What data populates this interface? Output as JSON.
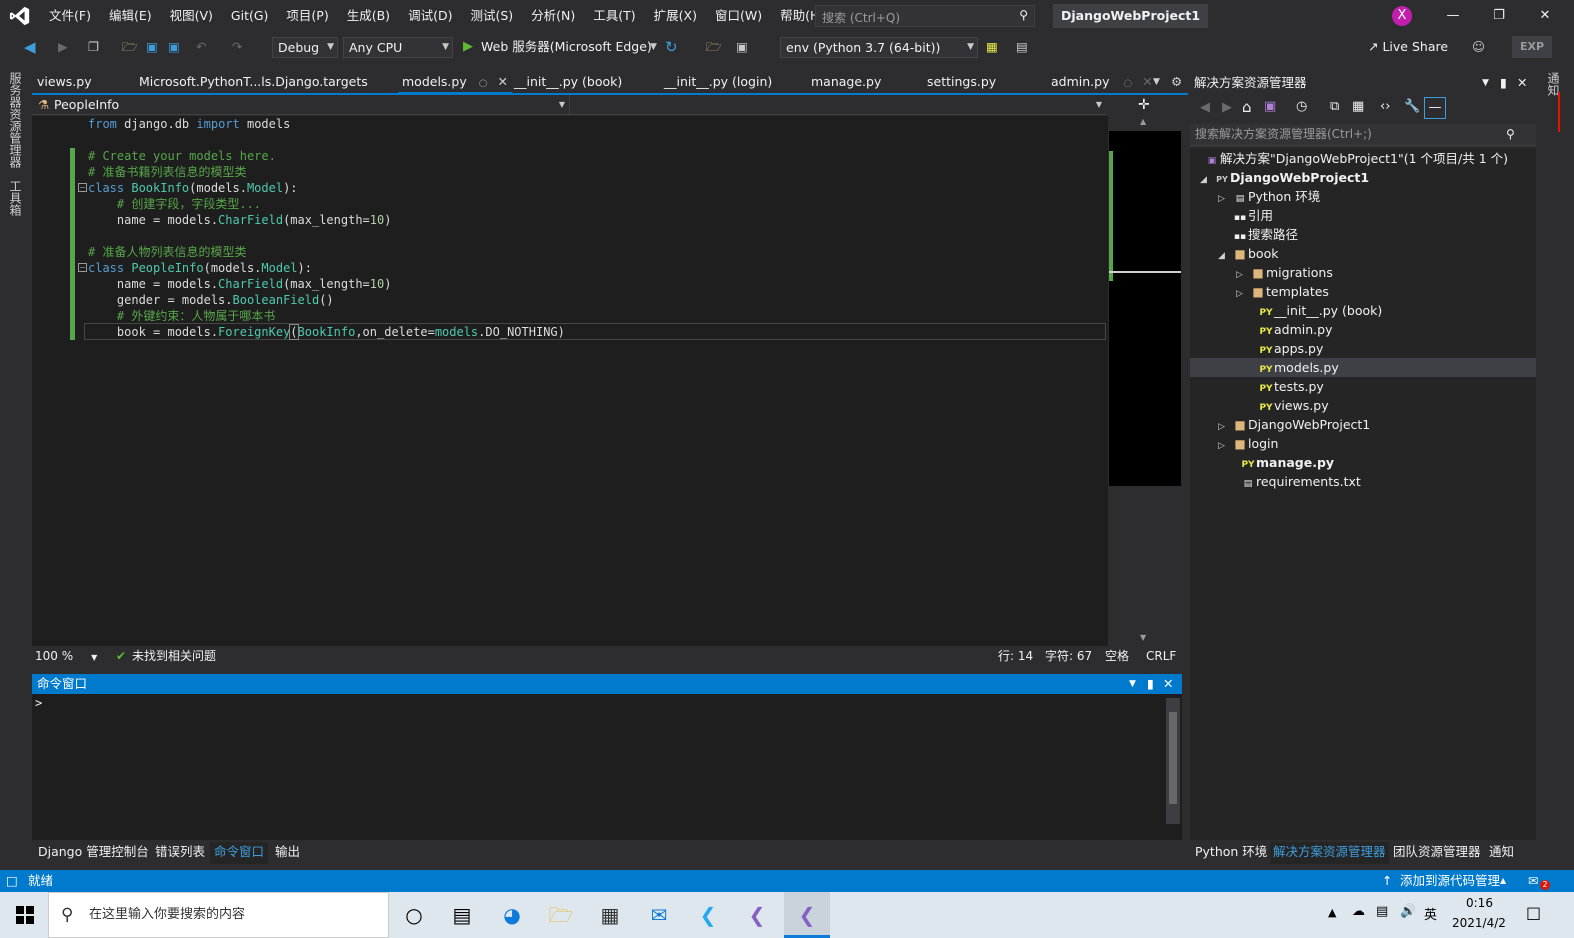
{
  "menu": {
    "items": [
      "文件(F)",
      "编辑(E)",
      "视图(V)",
      "Git(G)",
      "项目(P)",
      "生成(B)",
      "调试(D)",
      "测试(S)",
      "分析(N)",
      "工具(T)",
      "扩展(X)",
      "窗口(W)",
      "帮助(H)"
    ],
    "search_placeholder": "搜索 (Ctrl+Q)",
    "project_title": "DjangoWebProject1",
    "avatar_letter": "X"
  },
  "toolbar": {
    "config": "Debug",
    "platform": "Any CPU",
    "run_label": "Web 服务器(Microsoft Edge)",
    "env": "env (Python 3.7 (64-bit))",
    "live_share": "Live Share",
    "exp": "EXP"
  },
  "left_strip": {
    "server_explorer": "服务器资源管理器",
    "toolbox": "工具箱"
  },
  "doc_tabs": [
    {
      "label": "views.py"
    },
    {
      "label": "Microsoft.PythonT...ls.Django.targets"
    },
    {
      "label": "models.py"
    },
    {
      "label": "__init__.py (book)"
    },
    {
      "label": "__init__.py (login)"
    },
    {
      "label": "manage.py"
    },
    {
      "label": "settings.py"
    },
    {
      "label": "admin.py"
    }
  ],
  "navbar": {
    "class_selector": "PeopleInfo"
  },
  "code": {
    "l1_a": "from",
    "l1_b": " django.db ",
    "l1_c": "import",
    "l1_d": " models",
    "l3": "# Create your models here.",
    "l4": "# 准备书籍列表信息的模型类",
    "l5_a": "class",
    "l5_b": " ",
    "l5_c": "BookInfo",
    "l5_d": "(models.",
    "l5_e": "Model",
    "l5_f": "):",
    "l6": "    # 创建字段，字段类型...",
    "l7_a": "    name = models.",
    "l7_b": "CharField",
    "l7_c": "(max_length=",
    "l7_d": "10",
    "l7_e": ")",
    "l9": "# 准备人物列表信息的模型类",
    "l10_a": "class",
    "l10_b": " ",
    "l10_c": "PeopleInfo",
    "l10_d": "(models.",
    "l10_e": "Model",
    "l10_f": "):",
    "l11_a": "    name = models.",
    "l11_b": "CharField",
    "l11_c": "(max_length=",
    "l11_d": "10",
    "l11_e": ")",
    "l12_a": "    gender = models.",
    "l12_b": "BooleanField",
    "l12_c": "()",
    "l13": "    # 外键约束：人物属于哪本书",
    "l14_a": "    book = models.",
    "l14_b": "ForeignKey",
    "l14_c": "(",
    "l14_d": "BookInfo",
    "l14_e": ",on_delete=",
    "l14_f": "models",
    "l14_g": ".DO_NOTHING)"
  },
  "editor_status": {
    "zoom": "100 %",
    "issues": "未找到相关问题",
    "line": "行: 14",
    "char": "字符: 67",
    "whitespace": "空格",
    "eol": "CRLF"
  },
  "cmd_window": {
    "title": "命令窗口",
    "prompt": ">"
  },
  "bottom_tabs": [
    "Django 管理控制台",
    "错误列表",
    "命令窗口",
    "输出"
  ],
  "solution": {
    "title": "解决方案资源管理器",
    "search_placeholder": "搜索解决方案资源管理器(Ctrl+;)",
    "items": [
      {
        "label": "解决方案\"DjangoWebProject1\"(1 个项目/共 1 个)"
      },
      {
        "label": "DjangoWebProject1"
      },
      {
        "label": "Python 环境"
      },
      {
        "label": "引用"
      },
      {
        "label": "搜索路径"
      },
      {
        "label": "book"
      },
      {
        "label": "migrations"
      },
      {
        "label": "templates"
      },
      {
        "label": "__init__.py (book)"
      },
      {
        "label": "admin.py"
      },
      {
        "label": "apps.py"
      },
      {
        "label": "models.py"
      },
      {
        "label": "tests.py"
      },
      {
        "label": "views.py"
      },
      {
        "label": "DjangoWebProject1"
      },
      {
        "label": "login"
      },
      {
        "label": "manage.py"
      },
      {
        "label": "requirements.txt"
      }
    ],
    "bottom_tabs": [
      "Python 环境",
      "解决方案资源管理器",
      "团队资源管理器",
      "通知"
    ]
  },
  "right_strip": {
    "label": "通知"
  },
  "statusbar": {
    "ready": "就绪",
    "source_control": "添加到源代码管理",
    "notifications": "2"
  },
  "taskbar": {
    "search_placeholder": "在这里输入你要搜索的内容",
    "ime": "英",
    "time": "0:16",
    "date": "2021/4/2"
  },
  "colors": {
    "accent": "#007acc",
    "editor_bg": "#1e1e1e",
    "chrome_bg": "#2d2d30",
    "keyword": "#569cd6",
    "class": "#4ec9b0",
    "comment": "#57a64a",
    "number": "#b5cea8",
    "avatar": "#c21fae"
  }
}
